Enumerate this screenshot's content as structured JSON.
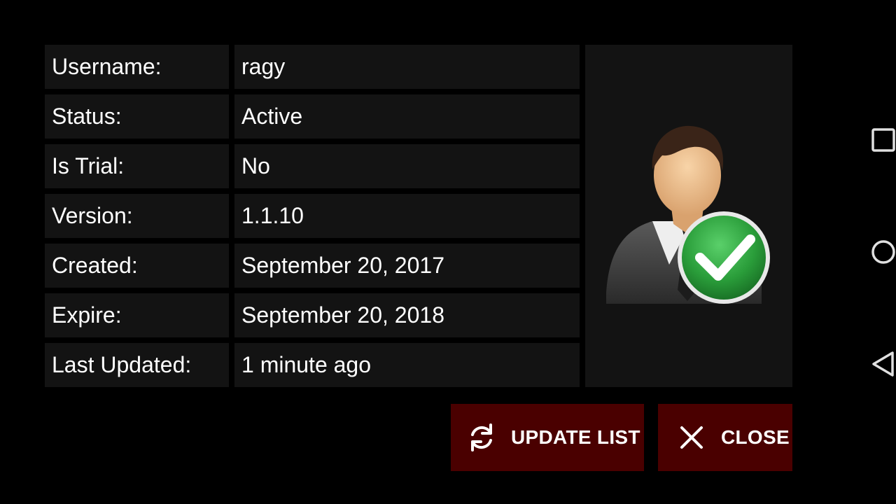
{
  "rows": [
    {
      "label": "Username:",
      "value": "ragy"
    },
    {
      "label": "Status:",
      "value": "Active"
    },
    {
      "label": "Is Trial:",
      "value": "No"
    },
    {
      "label": "Version:",
      "value": "1.1.10"
    },
    {
      "label": "Created:",
      "value": "September 20, 2017"
    },
    {
      "label": "Expire:",
      "value": "September 20, 2018"
    },
    {
      "label": "Last Updated:",
      "value": "1 minute ago"
    }
  ],
  "avatar": {
    "icon": "verified-user-icon",
    "badge_color": "#2a9d3a"
  },
  "buttons": {
    "update_list": {
      "label": "UPDATE LIST",
      "icon": "refresh-icon"
    },
    "close": {
      "label": "CLOSE",
      "icon": "close-icon"
    }
  },
  "colors": {
    "background": "#000000",
    "row_background": "#131313",
    "button_background": "#4a0000",
    "text": "#ffffff"
  },
  "navbar": {
    "items": [
      {
        "icon": "recent-apps-icon"
      },
      {
        "icon": "home-icon"
      },
      {
        "icon": "back-icon"
      }
    ]
  }
}
